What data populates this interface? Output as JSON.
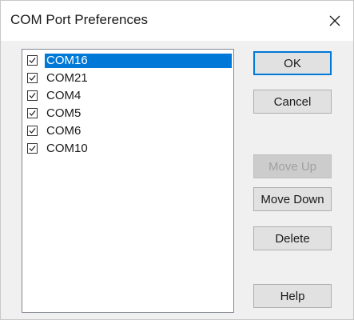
{
  "window": {
    "title": "COM Port Preferences",
    "close_icon": "close-icon"
  },
  "ports": [
    {
      "label": "COM16",
      "checked": true,
      "selected": true
    },
    {
      "label": "COM21",
      "checked": true,
      "selected": false
    },
    {
      "label": "COM4",
      "checked": true,
      "selected": false
    },
    {
      "label": "COM5",
      "checked": true,
      "selected": false
    },
    {
      "label": "COM6",
      "checked": true,
      "selected": false
    },
    {
      "label": "COM10",
      "checked": true,
      "selected": false
    }
  ],
  "buttons": {
    "ok": "OK",
    "cancel": "Cancel",
    "move_up": "Move Up",
    "move_down": "Move Down",
    "delete": "Delete",
    "help": "Help"
  },
  "colors": {
    "selection": "#0078d7",
    "default_button_border": "#0078d7"
  }
}
